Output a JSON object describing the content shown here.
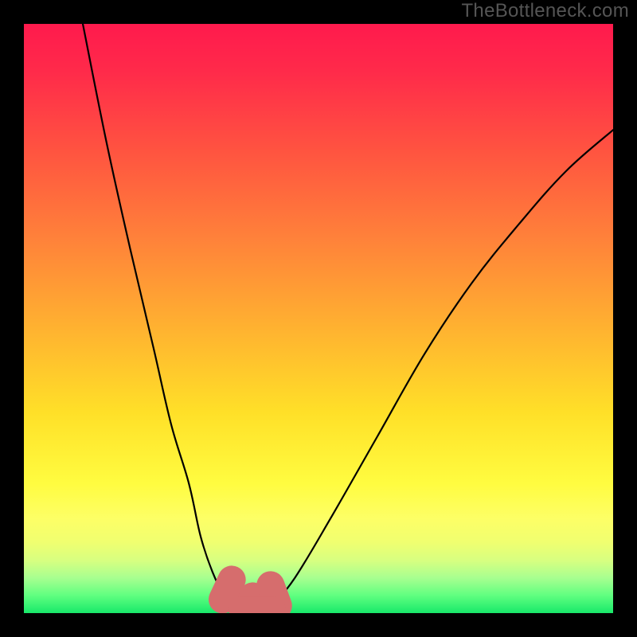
{
  "watermark": "TheBottleneck.com",
  "colors": {
    "frame": "#000000",
    "curve_stroke": "#000000",
    "blob_fill": "#d66d6d",
    "gradient_stops": [
      "#ff1a4d",
      "#ff2a4a",
      "#ff5540",
      "#ff803a",
      "#ffb330",
      "#ffe028",
      "#fffc40",
      "#fdff66",
      "#f0ff70",
      "#d8ff80",
      "#a8ff90",
      "#60ff80",
      "#18e86a"
    ]
  },
  "chart_data": {
    "type": "line",
    "title": "",
    "xlabel": "",
    "ylabel": "",
    "xlim": [
      0,
      100
    ],
    "ylim": [
      0,
      100
    ],
    "source_label": "TheBottleneck.com",
    "series": [
      {
        "name": "left-branch",
        "x": [
          10,
          14,
          18,
          22,
          25,
          28,
          30,
          32,
          34,
          36
        ],
        "y": [
          100,
          80,
          62,
          45,
          32,
          22,
          13,
          7,
          3,
          1
        ]
      },
      {
        "name": "flat-valley",
        "x": [
          36,
          38,
          40,
          42
        ],
        "y": [
          1,
          0.5,
          0.5,
          1
        ]
      },
      {
        "name": "right-branch",
        "x": [
          42,
          46,
          52,
          60,
          68,
          76,
          84,
          92,
          100
        ],
        "y": [
          1,
          6,
          16,
          30,
          44,
          56,
          66,
          75,
          82
        ]
      }
    ],
    "annotations": [
      {
        "name": "left-blob",
        "x": 34.5,
        "y": 4,
        "size": 2.2
      },
      {
        "name": "valley-blob",
        "x": 39,
        "y": 1,
        "size": 2.2
      },
      {
        "name": "right-blob",
        "x": 42.5,
        "y": 3,
        "size": 2.2
      }
    ]
  }
}
